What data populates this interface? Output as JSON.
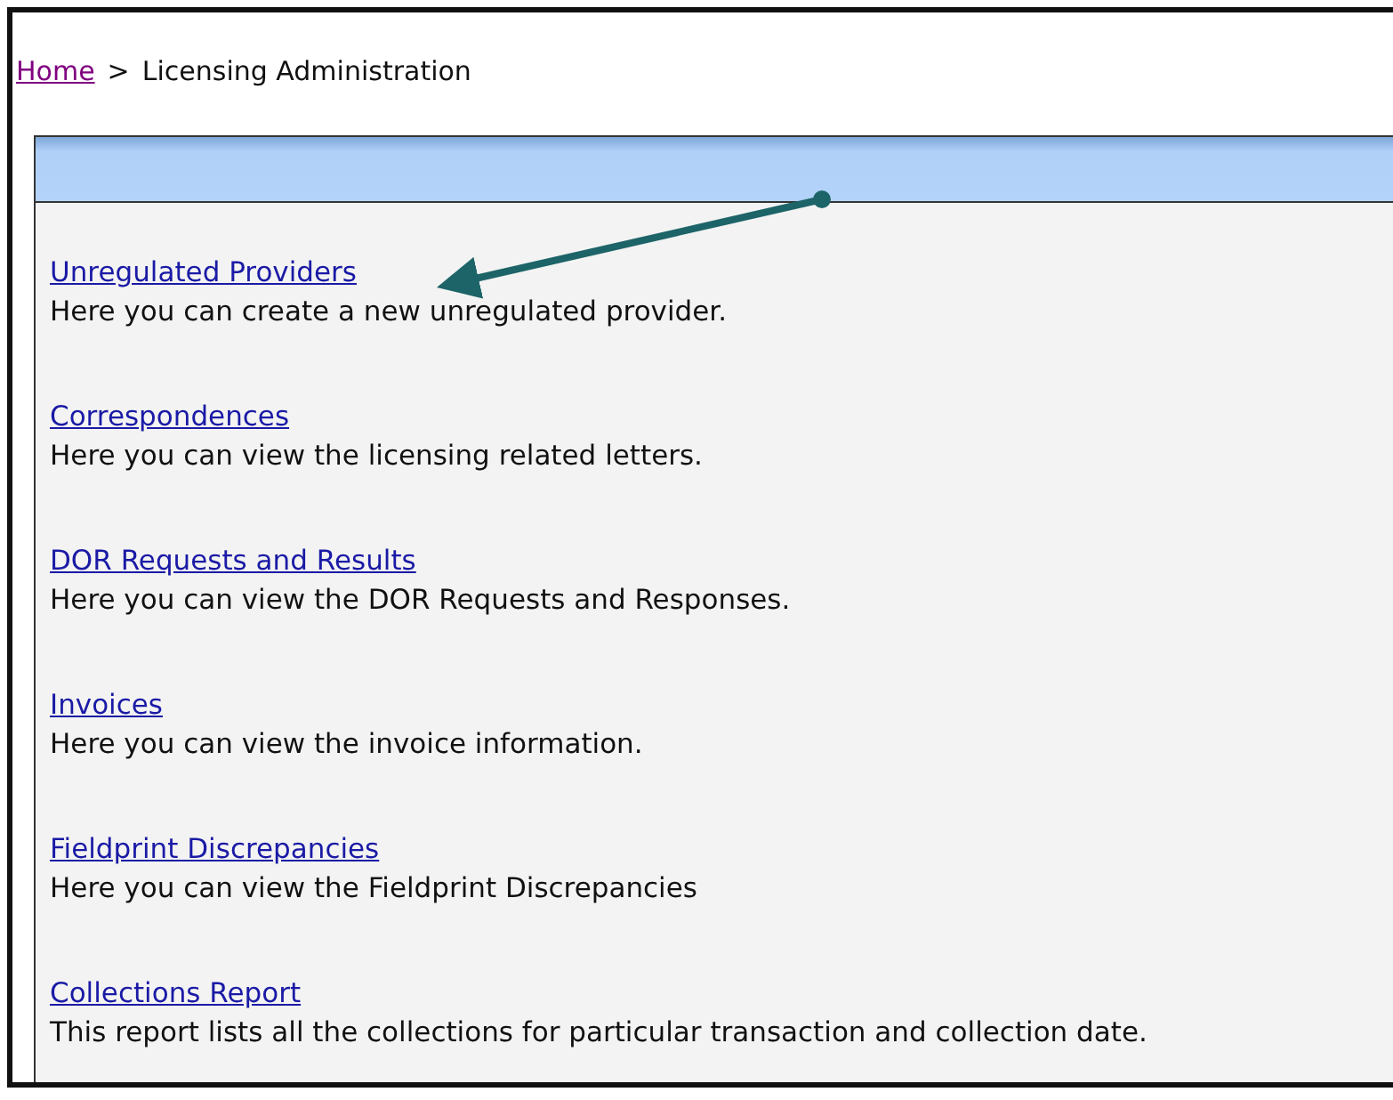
{
  "breadcrumb": {
    "home": "Home",
    "separator": ">",
    "current": "Licensing Administration"
  },
  "items": [
    {
      "title": "Unregulated Providers",
      "description": "Here you can create a new unregulated provider."
    },
    {
      "title": "Correspondences",
      "description": "Here you can view the licensing related letters."
    },
    {
      "title": "DOR Requests and Results",
      "description": "Here you can view the DOR Requests and Responses."
    },
    {
      "title": "Invoices",
      "description": "Here you can view the invoice information."
    },
    {
      "title": "Fieldprint Discrepancies",
      "description": "Here you can view the Fieldprint Discrepancies"
    },
    {
      "title": "Collections Report",
      "description": "This report lists all the collections for particular transaction and collection date."
    }
  ]
}
